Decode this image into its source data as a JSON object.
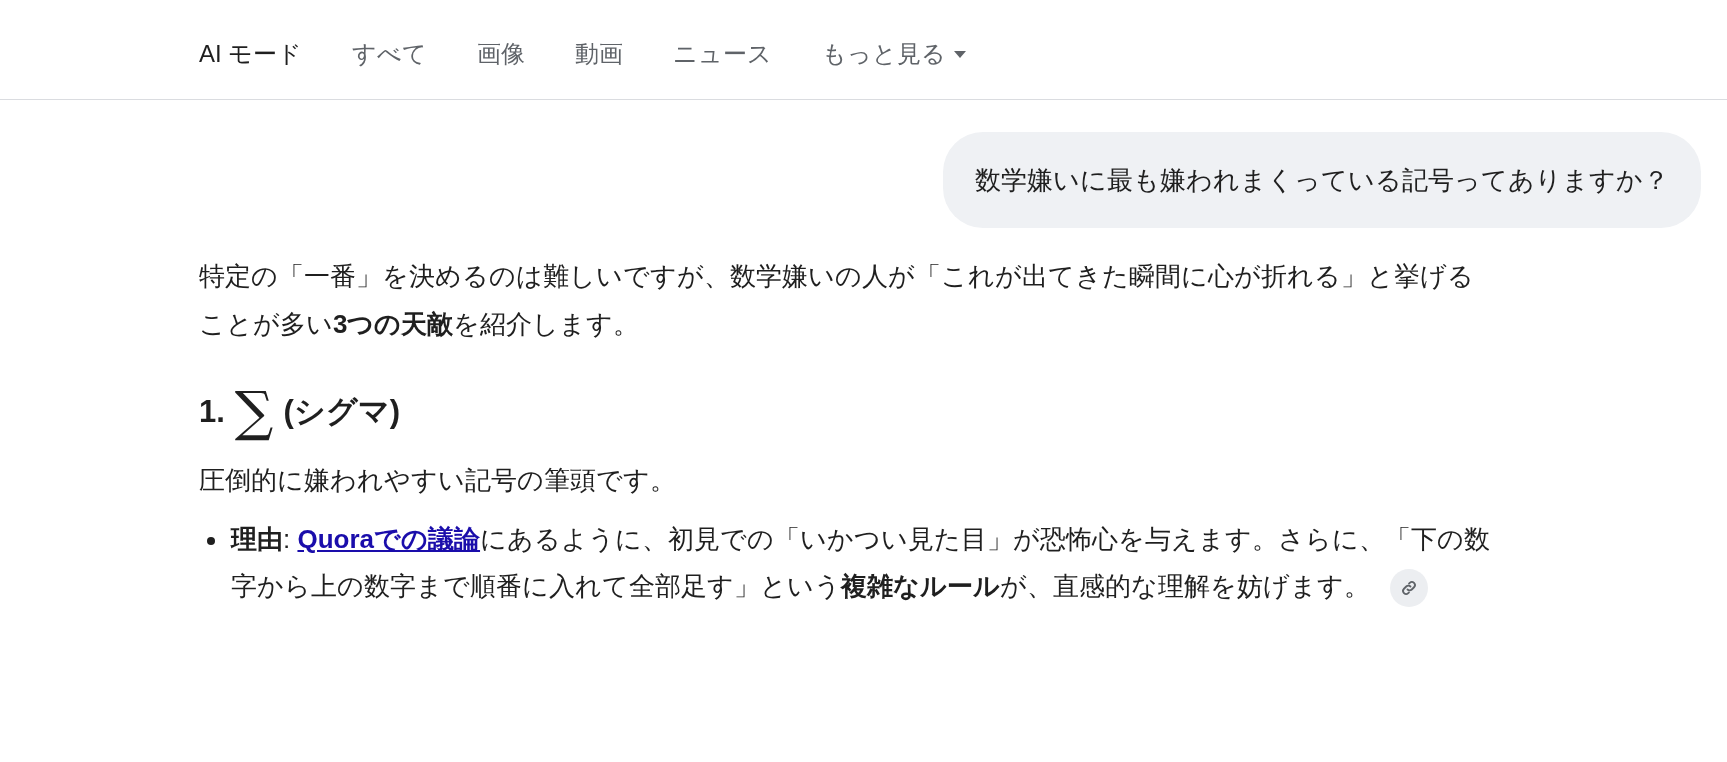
{
  "tabs": [
    {
      "label": "AI モード",
      "selected": true
    },
    {
      "label": "すべて",
      "selected": false
    },
    {
      "label": "画像",
      "selected": false
    },
    {
      "label": "動画",
      "selected": false
    },
    {
      "label": "ニュース",
      "selected": false
    },
    {
      "label": "もっと見る",
      "selected": false,
      "kind": "dropdown"
    }
  ],
  "query": "数学嫌いに最も嫌われまくっている記号ってありますか？",
  "answer": {
    "intro": "特定の「一番」を決めるのは難しいですが、数学嫌いの人が「これが出てきた瞬間に心が折れる」と挙げることが多い**3つの天敵**を紹介します。",
    "sections": [
      {
        "number": "1.",
        "symbol": "∑",
        "title": "(シグマ)",
        "description": "圧倒的に嫌われやすい記号の筆頭です。",
        "bullets": [
          {
            "lead": "**理由**: ",
            "link": "Quoraでの議論",
            "text": "にあるように、初見での「いかつい見た目」が恐怖心を与えます。さらに、「下の数字から上の数字まで順番に入れて全部足す」という**複雑なルール**が、直感的な理解を妨げます。"
          }
        ]
      }
    ]
  }
}
